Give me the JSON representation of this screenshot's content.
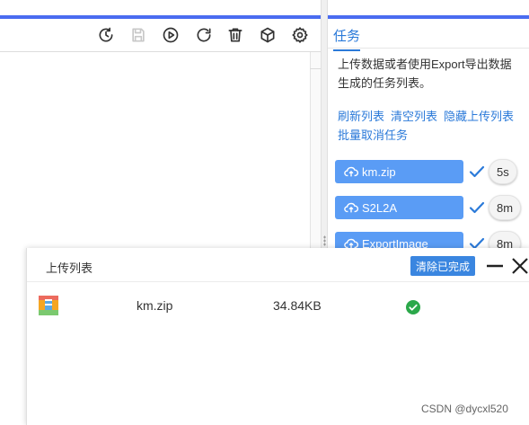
{
  "toolbar": {
    "icons": [
      "refresh-clock-icon",
      "save-icon",
      "play-icon",
      "reset-icon",
      "delete-icon",
      "package-icon",
      "settings-icon"
    ]
  },
  "tasks_panel": {
    "tab": "任务",
    "description": "上传数据或者使用Export导出数据生成的任务列表。",
    "links": {
      "refresh": "刷新列表",
      "clear": "清空列表",
      "hide_upload": "隐藏上传列表",
      "batch_cancel": "批量取消任务"
    },
    "tasks": [
      {
        "name": "km.zip",
        "time": "5s"
      },
      {
        "name": "S2L2A",
        "time": "8m"
      },
      {
        "name": "ExportImage",
        "time": "8m"
      }
    ]
  },
  "upload_dialog": {
    "title": "上传列表",
    "clear_completed": "清除已完成",
    "files": [
      {
        "name": "km.zip",
        "size": "34.84KB",
        "status": "completed"
      }
    ]
  },
  "watermark": "CSDN @dycxl520",
  "colors": {
    "accent_bar": "#4a6cf0",
    "link": "#2b7ad9",
    "task_button": "#5a9cf5",
    "success": "#2ba84a"
  }
}
